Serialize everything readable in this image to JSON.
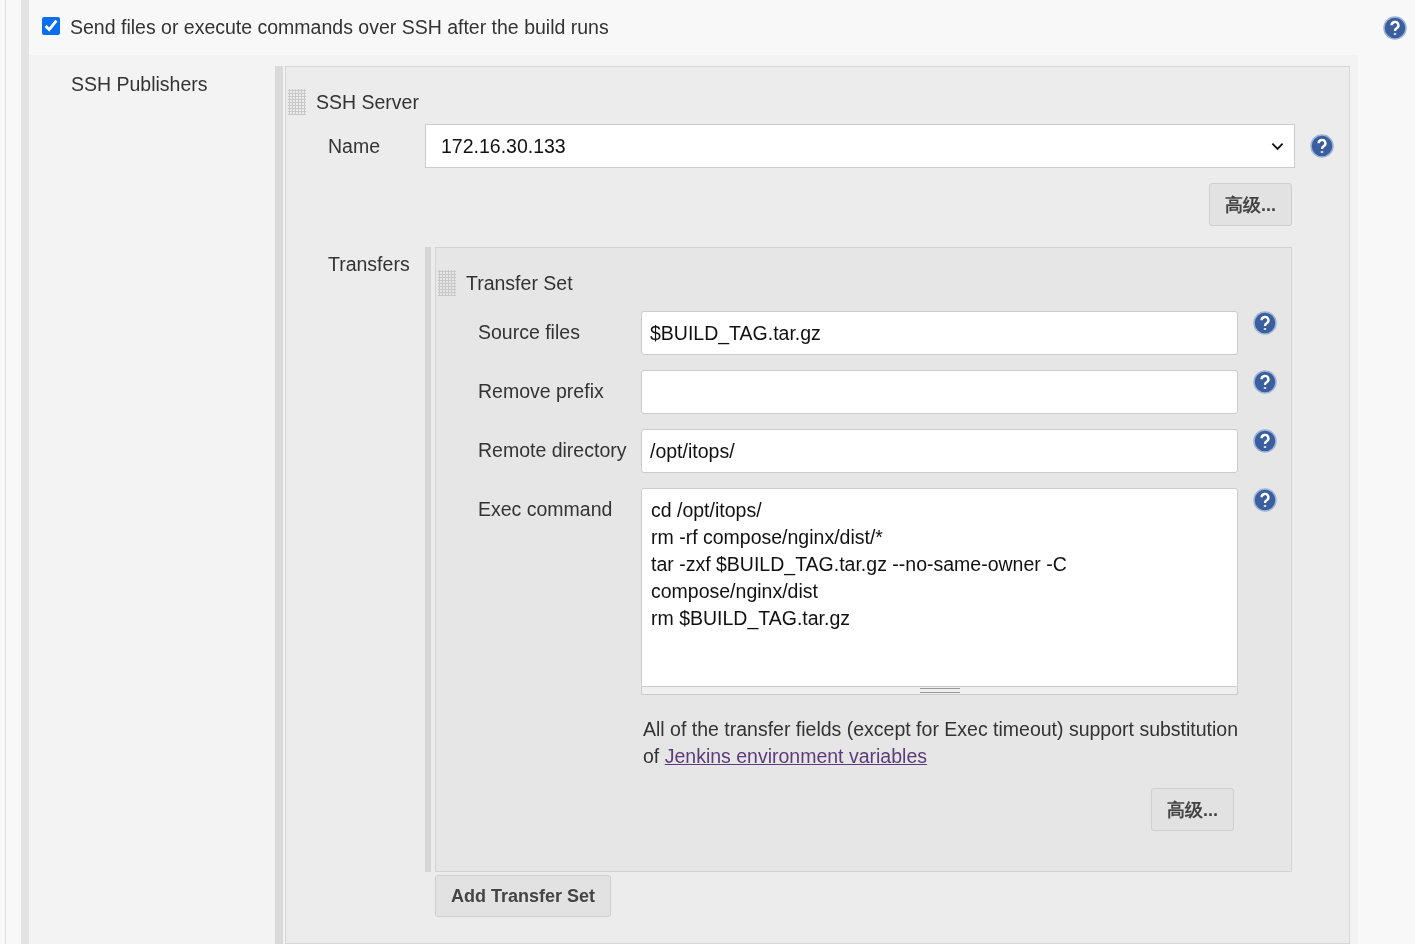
{
  "publish": {
    "label": "Send files or execute commands over SSH after the build runs",
    "checked": true
  },
  "section_label": "SSH Publishers",
  "server": {
    "title": "SSH Server",
    "name_label": "Name",
    "name_value": "172.16.30.133",
    "advanced_button": "高级..."
  },
  "transfers": {
    "label": "Transfers",
    "set": {
      "title": "Transfer Set",
      "fields": [
        {
          "kind": "input",
          "label": "Source files",
          "value": "$BUILD_TAG.tar.gz"
        },
        {
          "kind": "input",
          "label": "Remove prefix"
        },
        {
          "kind": "input",
          "label": "Remote directory",
          "value": "/opt/itops/"
        },
        {
          "kind": "textarea",
          "label": "Exec command",
          "value": "cd /opt/itops/\nrm -rf compose/nginx/dist/*\ntar -zxf $BUILD_TAG.tar.gz --no-same-owner -C\ncompose/nginx/dist\nrm $BUILD_TAG.tar.gz"
        }
      ],
      "note": "All of the transfer fields (except for Exec timeout) support substitution of",
      "note_link": "Jenkins environment variables",
      "advanced_button": "高级..."
    },
    "add_button": "Add Transfer Set"
  }
}
